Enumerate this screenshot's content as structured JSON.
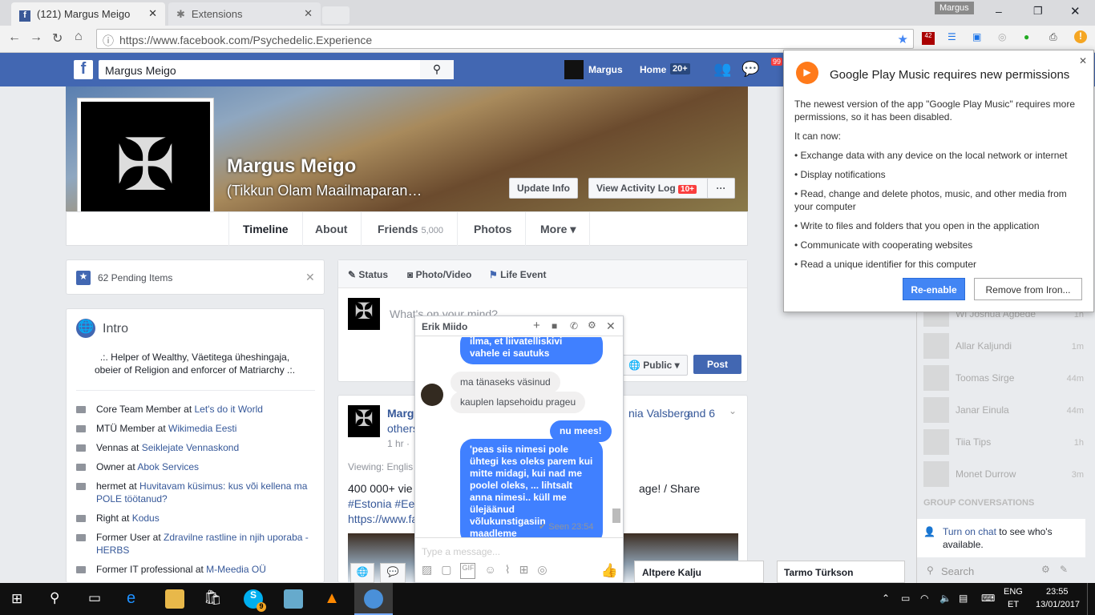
{
  "browser": {
    "tabs": [
      {
        "title": "(121) Margus Meigo"
      },
      {
        "title": "Extensions"
      }
    ],
    "user": "Margus",
    "url": "https://www.facebook.com/Psychedelic.Experience",
    "ext_badge": "42"
  },
  "header": {
    "search_value": "Margus Meigo",
    "profile_name": "Margus",
    "home_label": "Home",
    "home_count": "20+",
    "notif_count": "99"
  },
  "profile": {
    "name": "Margus Meigo",
    "subtitle": "(Tikkun Olam Maailmaparan…",
    "update_info": "Update Info",
    "activity_log": "View Activity Log",
    "activity_badge": "10+",
    "more_dots": "···",
    "tabs": [
      "Timeline",
      "About",
      "Friends",
      "Photos",
      "More"
    ],
    "friends_count": "5,000"
  },
  "pending": {
    "label": "62 Pending Items"
  },
  "intro": {
    "title": "Intro",
    "bio": ".:. Helper of Wealthy, Väetitega üheshingaja, obeier of Religion and enforcer of Matriarchy .:.",
    "items": [
      [
        "Core Team Member at ",
        "Let's do it World"
      ],
      [
        "MTÜ Member at ",
        "Wikimedia Eesti"
      ],
      [
        "Vennas at ",
        "Seiklejate Vennaskond"
      ],
      [
        "Owner at ",
        "Abok Services"
      ],
      [
        "hermet at ",
        "Huvitavam küsimus: kus või kellena ma POLE töötanud?"
      ],
      [
        "Right at ",
        "Kodus"
      ],
      [
        "Former User at ",
        "Zdravilne rastline in njih uporaba - HERBS"
      ],
      [
        "Former IT professional at ",
        "M-Meedia OÜ"
      ]
    ]
  },
  "composer": {
    "tabs": [
      "Status",
      "Photo/Video",
      "Life Event"
    ],
    "placeholder": "What's on your mind?",
    "privacy": "Public",
    "post": "Post"
  },
  "post": {
    "author": "Marg",
    "tagged": "nia Valsberg",
    "and": "and 6",
    "others": "others",
    "time": "1 hr ·",
    "viewing": "Viewing: Englis",
    "text1": "400 000+ vie",
    "text1b": "age! / Share",
    "hashtags": "#Estonia #Ee",
    "link": "https://www.fa"
  },
  "chat": {
    "name": "Erik Miido",
    "messages": [
      {
        "from": "me",
        "text": "ilma, et liivatelliskivi vahele ei sautuks"
      },
      {
        "from": "them",
        "text": "ma tänaseks väsinud"
      },
      {
        "from": "them",
        "text": "kauplen lapsehoidu prageu"
      },
      {
        "from": "me",
        "text": "nu mees!"
      },
      {
        "from": "me",
        "text": "'peas siis nimesi pole ühtegi kes oleks parem kui mitte midagi, kui nad me poolel oleks, ... lihtsalt anna nimesi.. küll me ülejäänud võlukunstigasiin maadleme"
      }
    ],
    "seen": "✔ Seen 23:54",
    "placeholder": "Type a message..."
  },
  "popup": {
    "title": "Google Play Music requires new permissions",
    "intro": "The newest version of the app \"Google Play Music\" requires more permissions, so it has been disabled.",
    "can_now": "It can now:",
    "perms": [
      "• Exchange data with any device on the local network or internet",
      "• Display notifications",
      "• Read, change and delete photos, music, and other media from your computer",
      "• Write to files and folders that you open in the application",
      "• Communicate with cooperating websites",
      "• Read a unique identifier for this computer"
    ],
    "reenable": "Re-enable",
    "remove": "Remove from Iron..."
  },
  "sidebar": {
    "friends": [
      {
        "name": "Wi Joshua Agbede",
        "time": "1h"
      },
      {
        "name": "Allar Kaljundi",
        "time": "1m"
      },
      {
        "name": "Toomas Sirge",
        "time": "44m"
      },
      {
        "name": "Janar Einula",
        "time": "44m"
      },
      {
        "name": "Tiia Tips",
        "time": "1h"
      },
      {
        "name": "Monet Durrow",
        "time": "3m"
      }
    ],
    "group_header": "GROUP CONVERSATIONS",
    "turn_on": "Turn on chat",
    "turn_on_rest": " to see who's available.",
    "search": "Search"
  },
  "docked": [
    "Altpere Kalju",
    "Tarmo Türkson"
  ],
  "taskbar": {
    "lang1": "ENG",
    "lang2": "ET",
    "time": "23:55",
    "date": "13/01/2017",
    "skype_badge": "9"
  }
}
